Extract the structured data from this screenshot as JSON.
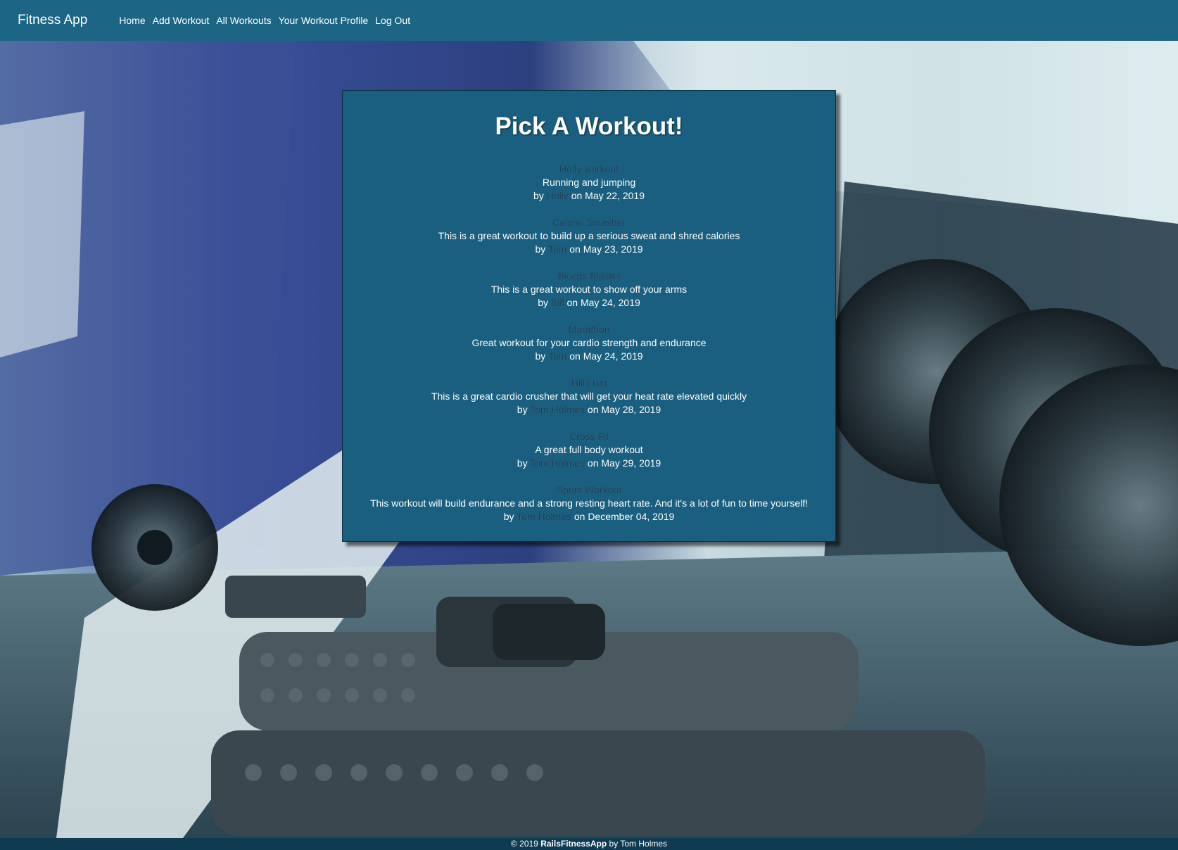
{
  "navbar": {
    "brand": "Fitness App",
    "links": [
      "Home",
      "Add Workout",
      "All Workouts",
      "Your Workout Profile",
      "Log Out"
    ]
  },
  "main": {
    "title": "Pick A Workout!",
    "by_prefix": "by",
    "on_prefix": "on",
    "workouts": [
      {
        "name": "Holly workout",
        "description": "Running and jumping",
        "author": "Holly",
        "date": "May 22, 2019"
      },
      {
        "name": "Calorie Smasher",
        "description": "This is a great workout to build up a serious sweat and shred calories",
        "author": "Tom",
        "date": "May 23, 2019"
      },
      {
        "name": "Biceps Blaster",
        "description": "This is a great workout to show off your arms",
        "author": "Bill",
        "date": "May 24, 2019"
      },
      {
        "name": "Marathon",
        "description": "Great workout for your cardio strength and endurance",
        "author": "Tom",
        "date": "May 24, 2019"
      },
      {
        "name": "Hills run",
        "description": "This is a great cardio crusher that will get your heat rate elevated quickly",
        "author": "Tom Holmes",
        "date": "May 28, 2019"
      },
      {
        "name": "Cross Fit",
        "description": "A great full body workout",
        "author": "Tom Holmes",
        "date": "May 29, 2019"
      },
      {
        "name": "Sprint Workout",
        "description": "This workout will build endurance and a strong resting heart rate. And it's a lot of fun to time yourself!",
        "author": "Tom Holmes",
        "date": "December 04, 2019"
      }
    ]
  },
  "footer": {
    "prefix": "© 2019 ",
    "app_name": "RailsFitnessApp",
    "suffix": " by Tom Holmes"
  },
  "colors": {
    "navbar": "#1c6584",
    "card": "#1a5f7f",
    "link": "#1c3d57",
    "footer": "#0e3a52"
  }
}
